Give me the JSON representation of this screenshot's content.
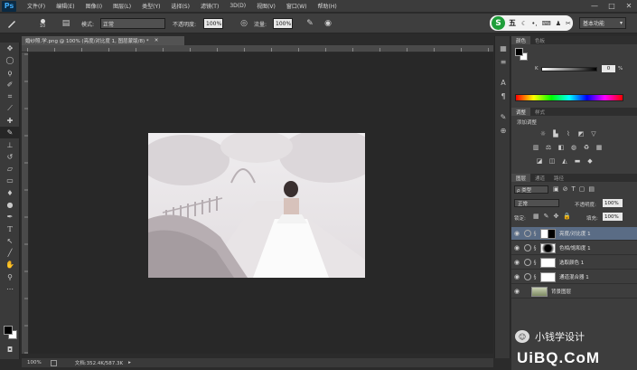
{
  "app": {
    "logo": "Ps"
  },
  "menu": [
    "文件(F)",
    "编辑(E)",
    "图像(I)",
    "图层(L)",
    "类型(Y)",
    "选择(S)",
    "滤镜(T)",
    "3D(D)",
    "视图(V)",
    "窗口(W)",
    "帮助(H)"
  ],
  "window_controls": [
    "—",
    "□",
    "✕"
  ],
  "options": {
    "brush_size": "10",
    "mode_label": "模式:",
    "mode_value": "正常",
    "opacity_label": "不透明度:",
    "opacity_value": "100%",
    "flow_label": "流量:",
    "flow_value": "100%",
    "workspace": "基本功能",
    "ime_text": "五"
  },
  "document": {
    "tab_title": "婚纱照.学.png @ 100% (亮度/对比度 1, 图层蒙版/8) *",
    "status_zoom": "100%",
    "status_doc": "文档:352.4K/587.3K"
  },
  "panels": {
    "color_tabs": [
      "颜色",
      "色板"
    ],
    "color_k_label": "K",
    "color_k_value": "0",
    "color_k_unit": "%",
    "adjust_tabs": [
      "调整",
      "样式"
    ],
    "adjust_title": "添加调整",
    "layers_tabs": [
      "图层",
      "通道",
      "路径"
    ],
    "layer_filter": "ρ 类型",
    "blend_mode": "正常",
    "opacity_label": "不透明度:",
    "opacity_value": "100%",
    "lock_label": "锁定:",
    "fill_label": "填充:",
    "fill_value": "100%",
    "layers": [
      {
        "name": "亮度/对比度 1",
        "selected": true
      },
      {
        "name": "色相/饱和度 1",
        "selected": false
      },
      {
        "name": "选取颜色 1",
        "selected": false
      },
      {
        "name": "通道混合器 1",
        "selected": false
      },
      {
        "name": "背景图层",
        "selected": false
      }
    ]
  },
  "watermark": {
    "line1": "小钱学设计",
    "line2": "UiBQ.CoM"
  },
  "colors": {
    "selected_layer": "#5a6c85",
    "photoshop_blue": "#3fa9f5"
  }
}
